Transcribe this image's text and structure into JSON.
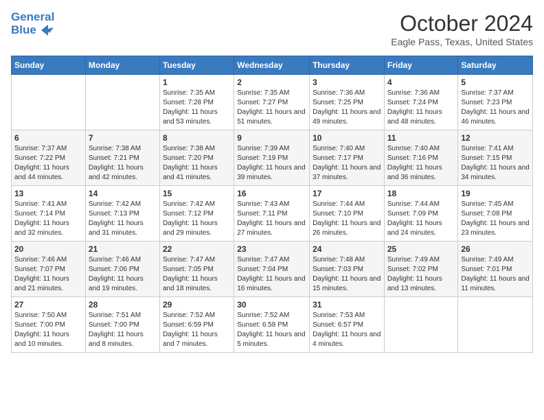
{
  "logo": {
    "line1": "General",
    "line2": "Blue"
  },
  "title": "October 2024",
  "subtitle": "Eagle Pass, Texas, United States",
  "days_header": [
    "Sunday",
    "Monday",
    "Tuesday",
    "Wednesday",
    "Thursday",
    "Friday",
    "Saturday"
  ],
  "weeks": [
    [
      {
        "day": "",
        "info": ""
      },
      {
        "day": "",
        "info": ""
      },
      {
        "day": "1",
        "info": "Sunrise: 7:35 AM\nSunset: 7:28 PM\nDaylight: 11 hours and 53 minutes."
      },
      {
        "day": "2",
        "info": "Sunrise: 7:35 AM\nSunset: 7:27 PM\nDaylight: 11 hours and 51 minutes."
      },
      {
        "day": "3",
        "info": "Sunrise: 7:36 AM\nSunset: 7:25 PM\nDaylight: 11 hours and 49 minutes."
      },
      {
        "day": "4",
        "info": "Sunrise: 7:36 AM\nSunset: 7:24 PM\nDaylight: 11 hours and 48 minutes."
      },
      {
        "day": "5",
        "info": "Sunrise: 7:37 AM\nSunset: 7:23 PM\nDaylight: 11 hours and 46 minutes."
      }
    ],
    [
      {
        "day": "6",
        "info": "Sunrise: 7:37 AM\nSunset: 7:22 PM\nDaylight: 11 hours and 44 minutes."
      },
      {
        "day": "7",
        "info": "Sunrise: 7:38 AM\nSunset: 7:21 PM\nDaylight: 11 hours and 42 minutes."
      },
      {
        "day": "8",
        "info": "Sunrise: 7:38 AM\nSunset: 7:20 PM\nDaylight: 11 hours and 41 minutes."
      },
      {
        "day": "9",
        "info": "Sunrise: 7:39 AM\nSunset: 7:19 PM\nDaylight: 11 hours and 39 minutes."
      },
      {
        "day": "10",
        "info": "Sunrise: 7:40 AM\nSunset: 7:17 PM\nDaylight: 11 hours and 37 minutes."
      },
      {
        "day": "11",
        "info": "Sunrise: 7:40 AM\nSunset: 7:16 PM\nDaylight: 11 hours and 36 minutes."
      },
      {
        "day": "12",
        "info": "Sunrise: 7:41 AM\nSunset: 7:15 PM\nDaylight: 11 hours and 34 minutes."
      }
    ],
    [
      {
        "day": "13",
        "info": "Sunrise: 7:41 AM\nSunset: 7:14 PM\nDaylight: 11 hours and 32 minutes."
      },
      {
        "day": "14",
        "info": "Sunrise: 7:42 AM\nSunset: 7:13 PM\nDaylight: 11 hours and 31 minutes."
      },
      {
        "day": "15",
        "info": "Sunrise: 7:42 AM\nSunset: 7:12 PM\nDaylight: 11 hours and 29 minutes."
      },
      {
        "day": "16",
        "info": "Sunrise: 7:43 AM\nSunset: 7:11 PM\nDaylight: 11 hours and 27 minutes."
      },
      {
        "day": "17",
        "info": "Sunrise: 7:44 AM\nSunset: 7:10 PM\nDaylight: 11 hours and 26 minutes."
      },
      {
        "day": "18",
        "info": "Sunrise: 7:44 AM\nSunset: 7:09 PM\nDaylight: 11 hours and 24 minutes."
      },
      {
        "day": "19",
        "info": "Sunrise: 7:45 AM\nSunset: 7:08 PM\nDaylight: 11 hours and 23 minutes."
      }
    ],
    [
      {
        "day": "20",
        "info": "Sunrise: 7:46 AM\nSunset: 7:07 PM\nDaylight: 11 hours and 21 minutes."
      },
      {
        "day": "21",
        "info": "Sunrise: 7:46 AM\nSunset: 7:06 PM\nDaylight: 11 hours and 19 minutes."
      },
      {
        "day": "22",
        "info": "Sunrise: 7:47 AM\nSunset: 7:05 PM\nDaylight: 11 hours and 18 minutes."
      },
      {
        "day": "23",
        "info": "Sunrise: 7:47 AM\nSunset: 7:04 PM\nDaylight: 11 hours and 16 minutes."
      },
      {
        "day": "24",
        "info": "Sunrise: 7:48 AM\nSunset: 7:03 PM\nDaylight: 11 hours and 15 minutes."
      },
      {
        "day": "25",
        "info": "Sunrise: 7:49 AM\nSunset: 7:02 PM\nDaylight: 11 hours and 13 minutes."
      },
      {
        "day": "26",
        "info": "Sunrise: 7:49 AM\nSunset: 7:01 PM\nDaylight: 11 hours and 11 minutes."
      }
    ],
    [
      {
        "day": "27",
        "info": "Sunrise: 7:50 AM\nSunset: 7:00 PM\nDaylight: 11 hours and 10 minutes."
      },
      {
        "day": "28",
        "info": "Sunrise: 7:51 AM\nSunset: 7:00 PM\nDaylight: 11 hours and 8 minutes."
      },
      {
        "day": "29",
        "info": "Sunrise: 7:52 AM\nSunset: 6:59 PM\nDaylight: 11 hours and 7 minutes."
      },
      {
        "day": "30",
        "info": "Sunrise: 7:52 AM\nSunset: 6:58 PM\nDaylight: 11 hours and 5 minutes."
      },
      {
        "day": "31",
        "info": "Sunrise: 7:53 AM\nSunset: 6:57 PM\nDaylight: 11 hours and 4 minutes."
      },
      {
        "day": "",
        "info": ""
      },
      {
        "day": "",
        "info": ""
      }
    ]
  ]
}
